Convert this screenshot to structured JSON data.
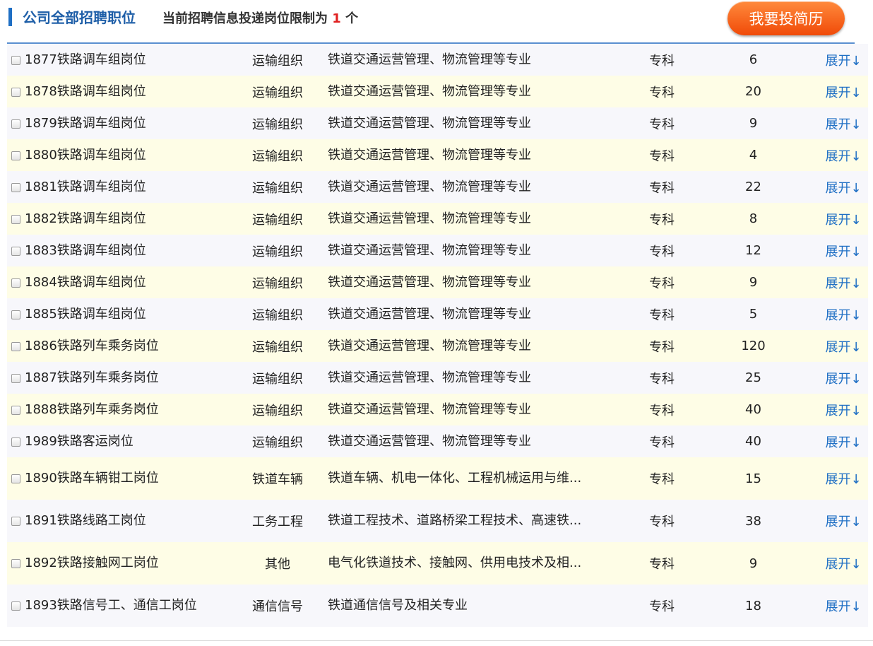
{
  "header": {
    "title": "公司全部招聘职位",
    "subtitle_prefix": "当前招聘信息投递岗位限制为",
    "limit": "1",
    "subtitle_suffix": "个",
    "apply_button": "我要投简历"
  },
  "colors": {
    "accent": "#1f6fc4",
    "limit_number": "#e02020",
    "button": "#f26b1d",
    "row_alt": "#fefde6"
  },
  "icons": {
    "checkbox": "checkbox-icon"
  },
  "rows": [
    {
      "name": "1877铁路调车组岗位",
      "category": "运输组织",
      "major": "铁道交通运营管理、物流管理等专业",
      "education": "专科",
      "count": "6",
      "action": "展开↓"
    },
    {
      "name": "1878铁路调车组岗位",
      "category": "运输组织",
      "major": "铁道交通运营管理、物流管理等专业",
      "education": "专科",
      "count": "20",
      "action": "展开↓"
    },
    {
      "name": "1879铁路调车组岗位",
      "category": "运输组织",
      "major": "铁道交通运营管理、物流管理等专业",
      "education": "专科",
      "count": "9",
      "action": "展开↓"
    },
    {
      "name": "1880铁路调车组岗位",
      "category": "运输组织",
      "major": "铁道交通运营管理、物流管理等专业",
      "education": "专科",
      "count": "4",
      "action": "展开↓"
    },
    {
      "name": "1881铁路调车组岗位",
      "category": "运输组织",
      "major": "铁道交通运营管理、物流管理等专业",
      "education": "专科",
      "count": "22",
      "action": "展开↓"
    },
    {
      "name": "1882铁路调车组岗位",
      "category": "运输组织",
      "major": "铁道交通运营管理、物流管理等专业",
      "education": "专科",
      "count": "8",
      "action": "展开↓"
    },
    {
      "name": "1883铁路调车组岗位",
      "category": "运输组织",
      "major": "铁道交通运营管理、物流管理等专业",
      "education": "专科",
      "count": "12",
      "action": "展开↓"
    },
    {
      "name": "1884铁路调车组岗位",
      "category": "运输组织",
      "major": "铁道交通运营管理、物流管理等专业",
      "education": "专科",
      "count": "9",
      "action": "展开↓"
    },
    {
      "name": "1885铁路调车组岗位",
      "category": "运输组织",
      "major": "铁道交通运营管理、物流管理等专业",
      "education": "专科",
      "count": "5",
      "action": "展开↓"
    },
    {
      "name": "1886铁路列车乘务岗位",
      "category": "运输组织",
      "major": "铁道交通运营管理、物流管理等专业",
      "education": "专科",
      "count": "120",
      "action": "展开↓"
    },
    {
      "name": "1887铁路列车乘务岗位",
      "category": "运输组织",
      "major": "铁道交通运营管理、物流管理等专业",
      "education": "专科",
      "count": "25",
      "action": "展开↓"
    },
    {
      "name": "1888铁路列车乘务岗位",
      "category": "运输组织",
      "major": "铁道交通运营管理、物流管理等专业",
      "education": "专科",
      "count": "40",
      "action": "展开↓"
    },
    {
      "name": "1989铁路客运岗位",
      "category": "运输组织",
      "major": "铁道交通运营管理、物流管理等专业",
      "education": "专科",
      "count": "40",
      "action": "展开↓"
    },
    {
      "name": "1890铁路车辆钳工岗位",
      "category": "铁道车辆",
      "major": "铁道车辆、机电一体化、工程机械运用与维...",
      "education": "专科",
      "count": "15",
      "action": "展开↓"
    },
    {
      "name": "1891铁路线路工岗位",
      "category": "工务工程",
      "major": "铁道工程技术、道路桥梁工程技术、高速铁...",
      "education": "专科",
      "count": "38",
      "action": "展开↓"
    },
    {
      "name": "1892铁路接触网工岗位",
      "category": "其他",
      "major": "电气化铁道技术、接触网、供用电技术及相...",
      "education": "专科",
      "count": "9",
      "action": "展开↓"
    },
    {
      "name": "1893铁路信号工、通信工岗位",
      "category": "通信信号",
      "major": "铁道通信信号及相关专业",
      "education": "专科",
      "count": "18",
      "action": "展开↓"
    }
  ]
}
